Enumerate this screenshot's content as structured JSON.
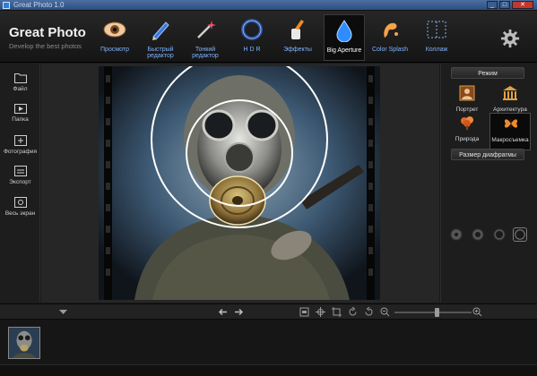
{
  "window": {
    "title": "Great Photo 1.0",
    "min": "_",
    "max": "□",
    "close": "✕"
  },
  "brand": {
    "name": "Great Photo",
    "tagline": "Develop the best photos"
  },
  "toolbar": {
    "tools": [
      {
        "id": "preview",
        "label": "Просмотр",
        "icon": "eye-icon"
      },
      {
        "id": "quick-edit",
        "label": "Быстрый редактор",
        "icon": "pencil-icon"
      },
      {
        "id": "fine-edit",
        "label": "Тонкий редактор",
        "icon": "magic-wand-icon"
      },
      {
        "id": "hdr",
        "label": "H D R",
        "icon": "ring-icon"
      },
      {
        "id": "effects",
        "label": "Эффекты",
        "icon": "brush-icon"
      },
      {
        "id": "big-aperture",
        "label": "Big Aperture",
        "icon": "water-drop-icon",
        "active": true
      },
      {
        "id": "color-splash",
        "label": "Color Splash",
        "icon": "splash-icon"
      },
      {
        "id": "collage",
        "label": "Коллаж",
        "icon": "collage-icon"
      }
    ],
    "settings_icon": "gear-icon"
  },
  "leftbar": {
    "items": [
      {
        "label": "Файл",
        "icon": "folder-icon"
      },
      {
        "label": "Папка",
        "icon": "folder-play-icon"
      },
      {
        "label": "Фотография",
        "icon": "add-photo-icon"
      },
      {
        "label": "Экспорт",
        "icon": "export-icon"
      },
      {
        "label": "Весь экран",
        "icon": "fullscreen-icon"
      }
    ]
  },
  "rightpanel": {
    "mode_header": "Режим",
    "modes": [
      {
        "label": "Портрет",
        "icon": "portrait-icon"
      },
      {
        "label": "Архитектура",
        "icon": "building-icon"
      },
      {
        "label": "Природа",
        "icon": "tree-icon"
      },
      {
        "label": "Макросъемка",
        "icon": "butterfly-icon",
        "active": true
      }
    ],
    "aperture_header": "Размер диафрагмы",
    "apertures": [
      {
        "icon": "aperture-small-icon"
      },
      {
        "icon": "aperture-medium-icon"
      },
      {
        "icon": "aperture-large-icon"
      },
      {
        "icon": "aperture-xlarge-icon",
        "selected": true
      }
    ]
  },
  "controls": {
    "collapse_icon": "triangle-down-icon",
    "prev_icon": "arrow-left-icon",
    "next_icon": "arrow-right-icon",
    "zoom_level": 0.55
  },
  "colors": {
    "accent_label": "#7fb2ff",
    "brand": "#f2f2f2",
    "background": "#1a1a1a"
  }
}
